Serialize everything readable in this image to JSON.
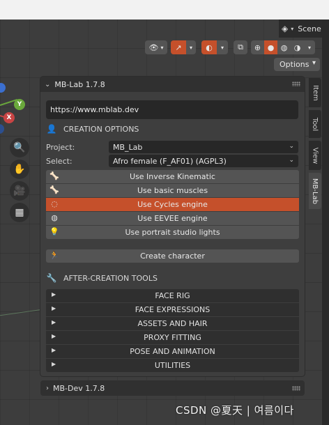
{
  "header": {
    "scene_label": "Scene",
    "options_label": "Options"
  },
  "colors": {
    "accent_selected": "#c5502b",
    "panel_bg": "#3e3e3e",
    "button_bg": "#545454",
    "field_bg": "#272727"
  },
  "viewport_tools": [
    {
      "name": "zoom-icon",
      "glyph": "⊕"
    },
    {
      "name": "hand-pan-icon",
      "glyph": "✋"
    },
    {
      "name": "camera-icon",
      "glyph": "🎥"
    },
    {
      "name": "grid-view-icon",
      "glyph": "▦"
    }
  ],
  "gizmo": {
    "y_label": "Y",
    "x_label": "X"
  },
  "panel": {
    "title": "MB-Lab 1.7.8",
    "url": "https://www.mblab.dev",
    "creation_section": "CREATION OPTIONS",
    "project_label": "Project:",
    "project_value": "MB_Lab",
    "select_label": "Select:",
    "select_value": "Afro female (F_AF01) (AGPL3)",
    "toggles": [
      {
        "label": "Use Inverse Kinematic",
        "icon": "bone-icon",
        "selected": false
      },
      {
        "label": "Use basic muscles",
        "icon": "bone-icon",
        "selected": false
      },
      {
        "label": "Use Cycles engine",
        "icon": "cycles-render-icon",
        "selected": true
      },
      {
        "label": "Use EEVEE engine",
        "icon": "eevee-render-icon",
        "selected": false
      },
      {
        "label": "Use portrait studio lights",
        "icon": "light-bulb-icon",
        "selected": false
      }
    ],
    "create_label": "Create character",
    "after_section": "AFTER-CREATION TOOLS",
    "subpanels": [
      "FACE RIG",
      "FACE EXPRESSIONS",
      "ASSETS AND HAIR",
      "PROXY FITTING",
      "POSE AND ANIMATION",
      "UTILITIES"
    ]
  },
  "second_panel": {
    "title": "MB-Dev 1.7.8"
  },
  "sidebar_tabs": [
    "Item",
    "Tool",
    "View",
    "MB-Lab"
  ],
  "watermark": "CSDN @夏天 | 여름이다"
}
